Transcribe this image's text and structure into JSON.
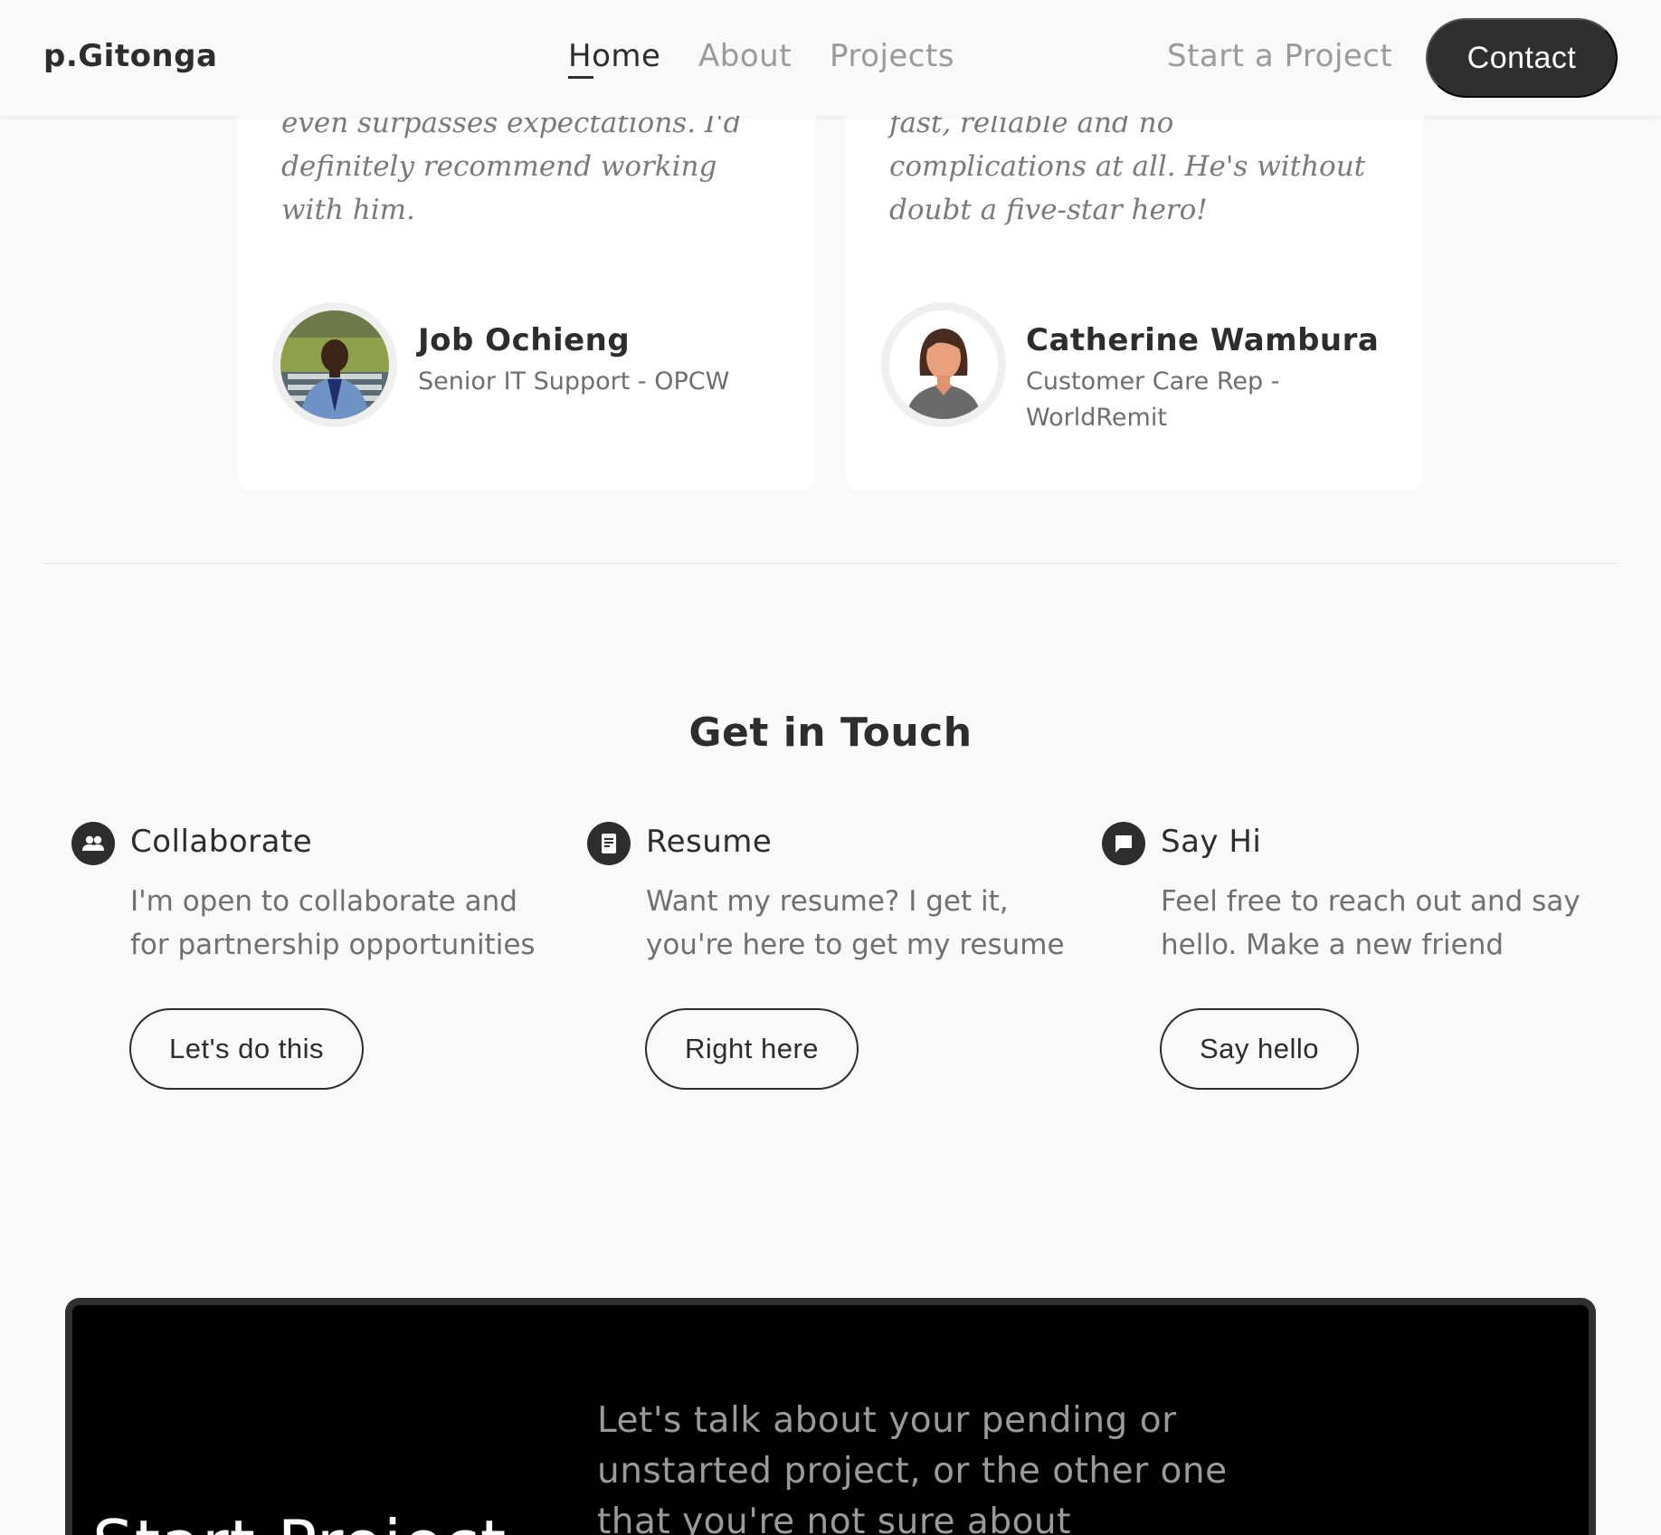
{
  "header": {
    "logo": "p.Gitonga",
    "nav": {
      "home": "Home",
      "about": "About",
      "projects": "Projects",
      "start_project": "Start a Project"
    },
    "contact_button": "Contact"
  },
  "testimonials": [
    {
      "quote": "even surpasses expectations. I'd definitely recommend working with him.",
      "name": "Job Ochieng",
      "role": "Senior IT Support - OPCW",
      "avatar": "photo-avatar"
    },
    {
      "quote": "fast, reliable and no complications at all. He's without doubt a five-star hero!",
      "name": "Catherine Wambura",
      "role": "Customer Care Rep - WorldRemit",
      "avatar": "default-female-avatar"
    }
  ],
  "touch": {
    "title": "Get in Touch",
    "columns": [
      {
        "icon": "people-icon",
        "title": "Collaborate",
        "text": "I'm open to collaborate and for partnership opportunities",
        "button": "Let's do this"
      },
      {
        "icon": "document-icon",
        "title": "Resume",
        "text": "Want my resume? I get it, you're here to get my resume",
        "button": "Right here"
      },
      {
        "icon": "chat-bubble-icon",
        "title": "Say Hi",
        "text": "Feel free to reach out and say hello. Make a new friend",
        "button": "Say hello"
      }
    ]
  },
  "banner": {
    "title": "Start Project",
    "text": "Let's talk about your pending or unstarted project, or the other one that you're not sure about"
  },
  "colors": {
    "background": "#f9f9f9",
    "text_dark": "#2d2d2d",
    "text_muted": "#9a9a9a",
    "banner": "#000000"
  }
}
